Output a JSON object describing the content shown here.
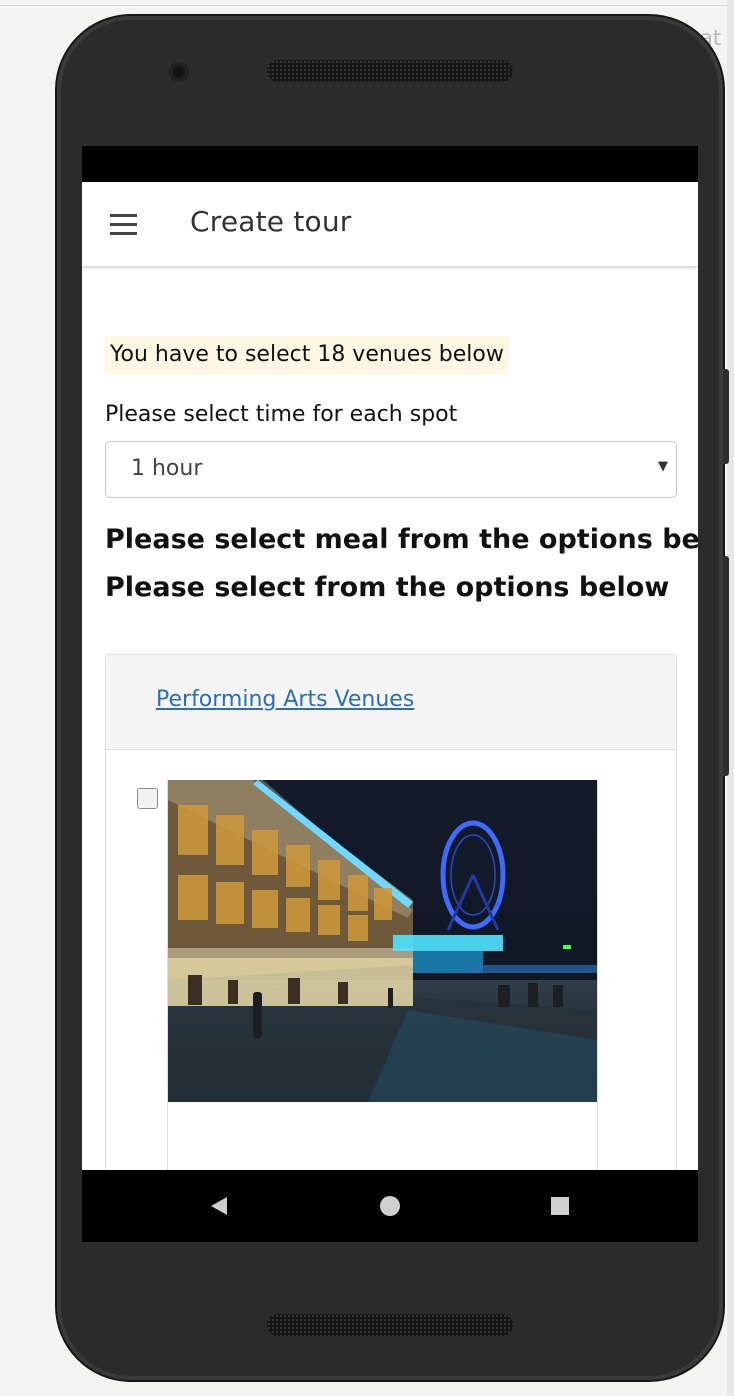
{
  "background": {
    "partial_text": "at"
  },
  "app_bar": {
    "title": "Create tour"
  },
  "content": {
    "notice": "You have to select 18 venues below",
    "time_label": "Please select time for each spot",
    "time_select": {
      "selected": "1 hour"
    },
    "heading_meal": "Please select meal from the options below",
    "heading_options": "Please select from the options below",
    "category_link": "Performing Arts Venues",
    "venue_checkbox_checked": false
  },
  "colors": {
    "notice_background": "#fcf8e3",
    "link": "#2a6fb5",
    "phone_body": "#2b2b2b"
  },
  "icons": {
    "menu": "hamburger-menu-icon",
    "select_arrow": "dropdown-arrow-icon",
    "nav_back": "triangle-back-icon",
    "nav_home": "circle-home-icon",
    "nav_recents": "square-recents-icon"
  }
}
